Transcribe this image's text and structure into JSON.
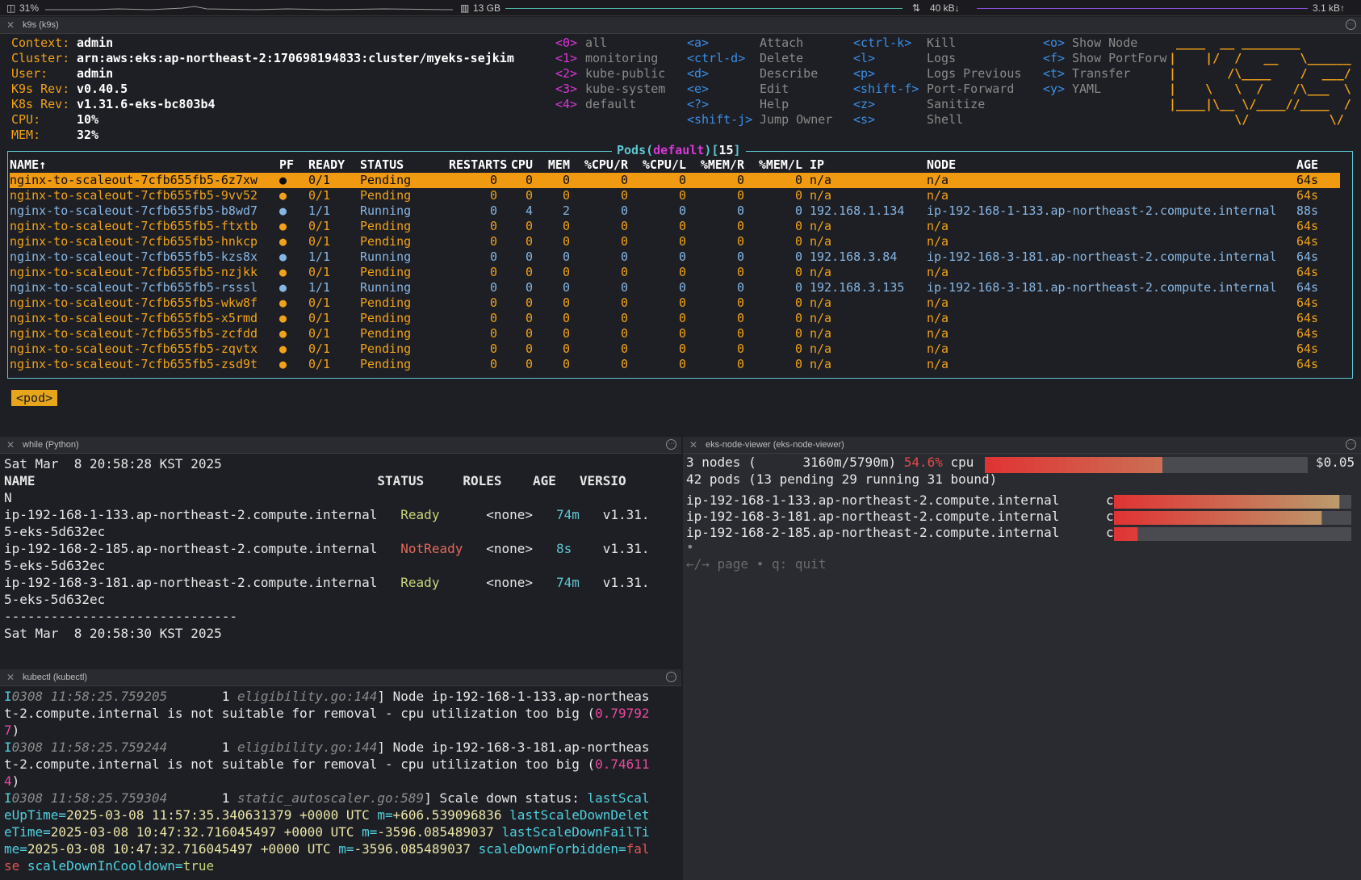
{
  "statusbar": {
    "cpu": "31%",
    "mem": "13 GB",
    "net_down": "40 kB↓",
    "net_up": "3.1 kB↑"
  },
  "k9s": {
    "pane_title": "k9s (k9s)",
    "info": [
      [
        "Context:",
        "admin"
      ],
      [
        "Cluster:",
        "arn:aws:eks:ap-northeast-2:170698194833:cluster/myeks-sejkim"
      ],
      [
        "User:",
        "admin"
      ],
      [
        "K9s Rev:",
        "v0.40.5"
      ],
      [
        "K8s Rev:",
        "v1.31.6-eks-bc803b4"
      ],
      [
        "CPU:",
        "10%"
      ],
      [
        "MEM:",
        "32%"
      ]
    ],
    "namespaces": [
      [
        "<0>",
        "all"
      ],
      [
        "<1>",
        "monitoring"
      ],
      [
        "<2>",
        "kube-public"
      ],
      [
        "<3>",
        "kube-system"
      ],
      [
        "<4>",
        "default"
      ]
    ],
    "hotkeys1": [
      [
        "<a>",
        "Attach"
      ],
      [
        "<ctrl-d>",
        "Delete"
      ],
      [
        "<d>",
        "Describe"
      ],
      [
        "<e>",
        "Edit"
      ],
      [
        "<?>",
        "Help"
      ],
      [
        "<shift-j>",
        "Jump Owner"
      ]
    ],
    "hotkeys2": [
      [
        "<ctrl-k>",
        "Kill"
      ],
      [
        "<l>",
        "Logs"
      ],
      [
        "<p>",
        "Logs Previous"
      ],
      [
        "<shift-f>",
        "Port-Forward"
      ],
      [
        "<z>",
        "Sanitize"
      ],
      [
        "<s>",
        "Shell"
      ]
    ],
    "hotkeys3": [
      [
        "<o>",
        "Show Node"
      ],
      [
        "<f>",
        "Show PortForw"
      ],
      [
        "<t>",
        "Transfer"
      ],
      [
        "<y>",
        "YAML"
      ]
    ],
    "logo": [
      " ____  __ ________       ",
      "|    |/  /   __   \\______ ",
      "|       /\\____    /  ___/ ",
      "|    \\   \\  /    /\\___  \\ ",
      "|____|\\__ \\/____//____  / ",
      "         \\/           \\/  "
    ],
    "table": {
      "title_prefix": "Pods(",
      "namespace": "default",
      "title_mid": ")[",
      "count": "15",
      "title_suffix": "]",
      "headers": [
        "NAME↑",
        "PF",
        "READY",
        "STATUS",
        "RESTARTS",
        "CPU",
        "MEM",
        "%CPU/R",
        "%CPU/L",
        "%MEM/R",
        "%MEM/L",
        "IP",
        "NODE",
        "AGE"
      ],
      "rows": [
        [
          "nginx-to-scaleout-7cfb655fb5-6z7xw",
          "●",
          "0/1",
          "Pending",
          "0",
          "0",
          "0",
          "0",
          "0",
          "0",
          "0",
          "n/a",
          "n/a",
          "64s"
        ],
        [
          "nginx-to-scaleout-7cfb655fb5-9vv52",
          "●",
          "0/1",
          "Pending",
          "0",
          "0",
          "0",
          "0",
          "0",
          "0",
          "0",
          "n/a",
          "n/a",
          "64s"
        ],
        [
          "nginx-to-scaleout-7cfb655fb5-b8wd7",
          "●",
          "1/1",
          "Running",
          "0",
          "4",
          "2",
          "0",
          "0",
          "0",
          "0",
          "192.168.1.134",
          "ip-192-168-1-133.ap-northeast-2.compute.internal",
          "88s"
        ],
        [
          "nginx-to-scaleout-7cfb655fb5-ftxtb",
          "●",
          "0/1",
          "Pending",
          "0",
          "0",
          "0",
          "0",
          "0",
          "0",
          "0",
          "n/a",
          "n/a",
          "64s"
        ],
        [
          "nginx-to-scaleout-7cfb655fb5-hnkcp",
          "●",
          "0/1",
          "Pending",
          "0",
          "0",
          "0",
          "0",
          "0",
          "0",
          "0",
          "n/a",
          "n/a",
          "64s"
        ],
        [
          "nginx-to-scaleout-7cfb655fb5-kzs8x",
          "●",
          "1/1",
          "Running",
          "0",
          "0",
          "0",
          "0",
          "0",
          "0",
          "0",
          "192.168.3.84",
          "ip-192-168-3-181.ap-northeast-2.compute.internal",
          "64s"
        ],
        [
          "nginx-to-scaleout-7cfb655fb5-nzjkk",
          "●",
          "0/1",
          "Pending",
          "0",
          "0",
          "0",
          "0",
          "0",
          "0",
          "0",
          "n/a",
          "n/a",
          "64s"
        ],
        [
          "nginx-to-scaleout-7cfb655fb5-rsssl",
          "●",
          "1/1",
          "Running",
          "0",
          "0",
          "0",
          "0",
          "0",
          "0",
          "0",
          "192.168.3.135",
          "ip-192-168-3-181.ap-northeast-2.compute.internal",
          "64s"
        ],
        [
          "nginx-to-scaleout-7cfb655fb5-wkw8f",
          "●",
          "0/1",
          "Pending",
          "0",
          "0",
          "0",
          "0",
          "0",
          "0",
          "0",
          "n/a",
          "n/a",
          "64s"
        ],
        [
          "nginx-to-scaleout-7cfb655fb5-x5rmd",
          "●",
          "0/1",
          "Pending",
          "0",
          "0",
          "0",
          "0",
          "0",
          "0",
          "0",
          "n/a",
          "n/a",
          "64s"
        ],
        [
          "nginx-to-scaleout-7cfb655fb5-zcfdd",
          "●",
          "0/1",
          "Pending",
          "0",
          "0",
          "0",
          "0",
          "0",
          "0",
          "0",
          "n/a",
          "n/a",
          "64s"
        ],
        [
          "nginx-to-scaleout-7cfb655fb5-zqvtx",
          "●",
          "0/1",
          "Pending",
          "0",
          "0",
          "0",
          "0",
          "0",
          "0",
          "0",
          "n/a",
          "n/a",
          "64s"
        ],
        [
          "nginx-to-scaleout-7cfb655fb5-zsd9t",
          "●",
          "0/1",
          "Pending",
          "0",
          "0",
          "0",
          "0",
          "0",
          "0",
          "0",
          "n/a",
          "n/a",
          "64s"
        ]
      ]
    },
    "crumb": "<pod>"
  },
  "watch": {
    "pane_title": "while (Python)",
    "lines": [
      "Sat Mar  8 20:58:28 KST 2025",
      "NAME                                            STATUS     ROLES    AGE   VERSIO",
      "N",
      "ip-192-168-1-133.ap-northeast-2.compute.internal   Ready      <none>   74m   v1.31.",
      "5-eks-5d632ec",
      "ip-192-168-2-185.ap-northeast-2.compute.internal   NotReady   <none>   8s    v1.31.",
      "5-eks-5d632ec",
      "ip-192-168-3-181.ap-northeast-2.compute.internal   Ready      <none>   74m   v1.31.",
      "5-eks-5d632ec",
      "------------------------------",
      "Sat Mar  8 20:58:30 KST 2025",
      "",
      "_"
    ]
  },
  "viewer": {
    "pane_title": "eks-node-viewer (eks-node-viewer)",
    "summary_a": "3 nodes (      3160m/5790m) ",
    "summary_pct": "54.6%",
    "summary_b": " cpu",
    "price": "$0.05",
    "pods_line": "42 pods (13 pending 29 running 31 bound)",
    "total_cpu_fraction": 0.546,
    "nodes": [
      {
        "name": "ip-192-168-1-133.ap-northeast-2.compute.internal",
        "label": "cpu",
        "fraction": 0.95
      },
      {
        "name": "ip-192-168-3-181.ap-northeast-2.compute.internal",
        "label": "cpu",
        "fraction": 0.88
      },
      {
        "name": "ip-192-168-2-185.ap-northeast-2.compute.internal",
        "label": "cpu",
        "fraction": 0.1
      }
    ],
    "bullet": "•",
    "help": "←/→ page • q: quit"
  },
  "kubectl": {
    "pane_title": "kubectl (kubectl)",
    "l1a": "I",
    "l1b": "0308 11:58:25.759205",
    "l1c": "       1 ",
    "l1d": "eligibility.go:144",
    "l1e": "] Node ip-192-168-1-133.ap-northeas",
    "l2a": "t-2.compute.internal is not suitable for removal - cpu utilization too big (",
    "l2b": "0.79792",
    "l3a": "7",
    ")": ")",
    "l4a": "I",
    "l4b": "0308 11:58:25.759244",
    "l4c": "       1 ",
    "l4d": "eligibility.go:144",
    "l4e": "] Node ip-192-168-3-181.ap-northeas",
    "l5a": "t-2.compute.internal is not suitable for removal - cpu utilization too big (",
    "l5b": "0.74611",
    "l6a": "4",
    "l7a": "I",
    "l7b": "0308 11:58:25.759304",
    "l7c": "       1 ",
    "l7d": "static_autoscaler.go:589",
    "l7e": "] Scale down status: ",
    "l7f": "lastScal",
    "l8a": "eUpTime=",
    "l8b": "2025-03-08 11:57:35.340631379 +0000 UTC ",
    "l8c": "m=",
    "l8d": "+606.539096836 ",
    "l8e": "lastScaleDownDelet",
    "l9a": "eTime=",
    "l9b": "2025-03-08 10:47:32.716045497 +0000 UTC ",
    "l9c": "m=",
    "l9d": "-3596.085489037 ",
    "l9e": "lastScaleDownFailTi",
    "l10a": "me=",
    "l10b": "2025-03-08 10:47:32.716045497 +0000 UTC ",
    "l10c": "m=",
    "l10d": "-3596.085489037 ",
    "l10e": "scaleDownForbidden=",
    "l10f": "fal",
    "l11a": "se ",
    "l11b": "scaleDownInCooldown=",
    "l11c": "true"
  }
}
